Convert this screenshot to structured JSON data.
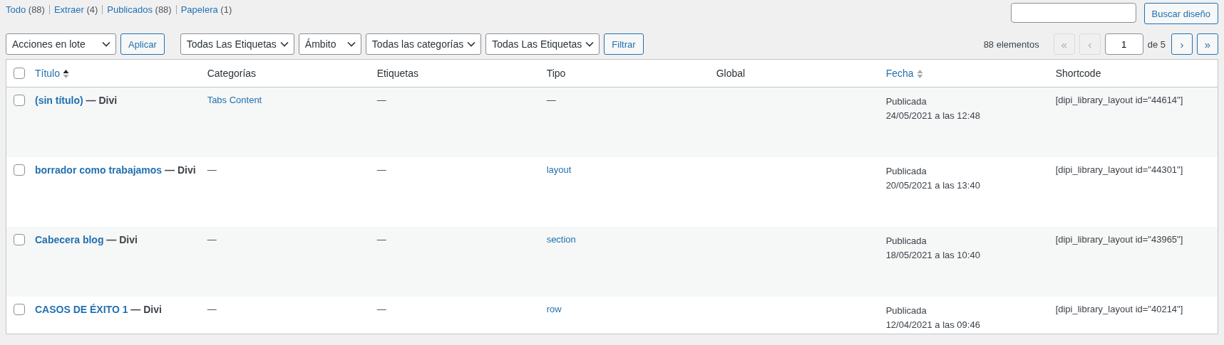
{
  "status_links": [
    {
      "label": "Todo",
      "count": "(88)"
    },
    {
      "label": "Extraer",
      "count": "(4)"
    },
    {
      "label": "Publicados",
      "count": "(88)"
    },
    {
      "label": "Papelera",
      "count": "(1)"
    }
  ],
  "search": {
    "button": "Buscar diseño"
  },
  "bulk": {
    "select": "Acciones en lote",
    "button": "Aplicar"
  },
  "filters": {
    "selects": [
      "Todas Las Etiquetas",
      "Ámbito",
      "Todas las categorías",
      "Todas Las Etiquetas"
    ],
    "button": "Filtrar"
  },
  "pagination": {
    "count": "88 elementos",
    "first": {
      "label": "«",
      "disabled": true
    },
    "prev": {
      "label": "‹",
      "disabled": true
    },
    "page": "1",
    "of": "de 5",
    "next": {
      "label": "›",
      "disabled": false
    },
    "last": {
      "label": "»",
      "disabled": false
    }
  },
  "table": {
    "select_all": {
      "checked": false
    },
    "columns": [
      {
        "label": "Título",
        "kind": "sortable",
        "sorted_ascending": true
      },
      {
        "label": "Categorías",
        "kind": "plain"
      },
      {
        "label": "Etiquetas",
        "kind": "plain"
      },
      {
        "label": "Tipo",
        "kind": "plain"
      },
      {
        "label": "Global",
        "kind": "plain"
      },
      {
        "label": "Fecha",
        "kind": "sortable",
        "sorted_ascending": false
      },
      {
        "label": "Shortcode",
        "kind": "plain"
      }
    ],
    "rows": [
      {
        "checked": false,
        "title": "(sin título)",
        "suffix": "— Divi",
        "categories": {
          "text": "Tabs Content",
          "link": true
        },
        "tags": {
          "text": "—",
          "link": false
        },
        "type": {
          "text": "—",
          "link": false
        },
        "status": "Publicada",
        "date": "24/05/2021 a las 12:48",
        "shortcode": "[dipi_library_layout id=\"44614\"]"
      },
      {
        "checked": false,
        "title": "borrador como trabajamos",
        "suffix": "— Divi",
        "categories": {
          "text": "—",
          "link": false
        },
        "tags": {
          "text": "—",
          "link": false
        },
        "type": {
          "text": "layout",
          "link": true
        },
        "status": "Publicada",
        "date": "20/05/2021 a las 13:40",
        "shortcode": "[dipi_library_layout id=\"44301\"]"
      },
      {
        "checked": false,
        "title": "Cabecera blog",
        "suffix": "— Divi",
        "categories": {
          "text": "—",
          "link": false
        },
        "tags": {
          "text": "—",
          "link": false
        },
        "type": {
          "text": "section",
          "link": true
        },
        "status": "Publicada",
        "date": "18/05/2021 a las 10:40",
        "shortcode": "[dipi_library_layout id=\"43965\"]"
      },
      {
        "checked": false,
        "title": "CASOS DE ÉXITO 1",
        "suffix": "— Divi",
        "categories": {
          "text": "—",
          "link": false
        },
        "tags": {
          "text": "—",
          "link": false
        },
        "type": {
          "text": "row",
          "link": true
        },
        "status": "Publicada",
        "date": "12/04/2021 a las 09:46",
        "shortcode": "[dipi_library_layout id=\"40214\"]"
      }
    ]
  }
}
